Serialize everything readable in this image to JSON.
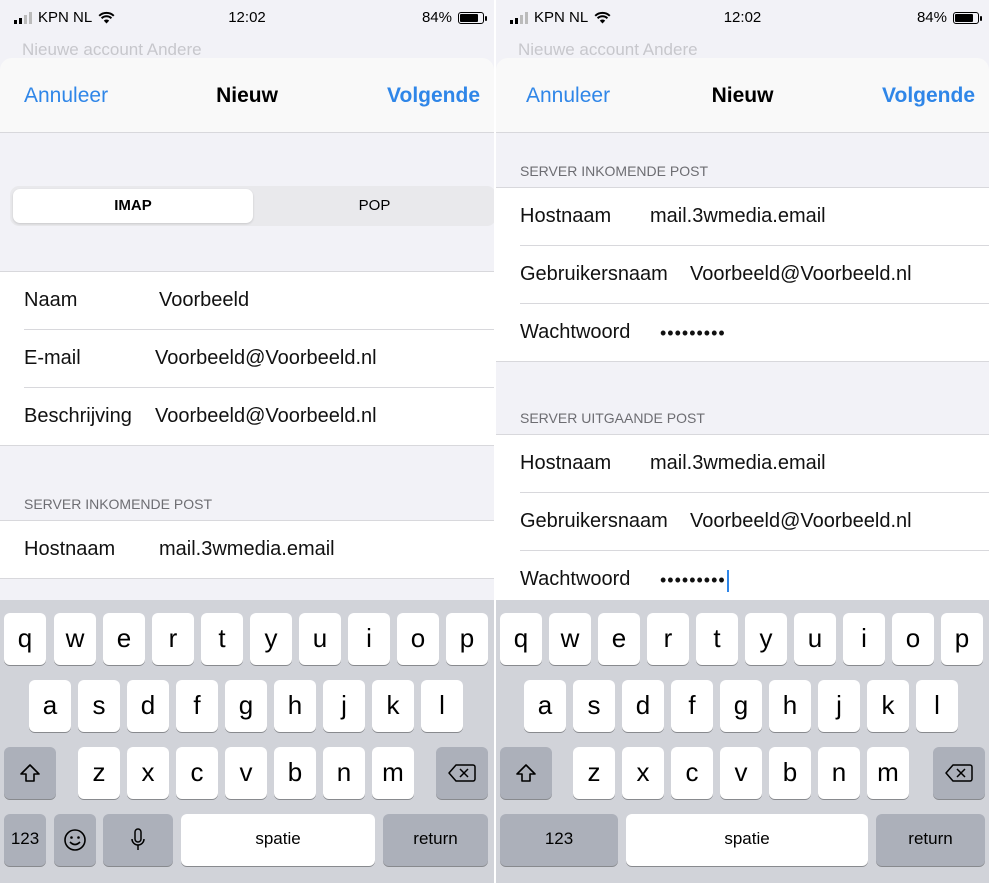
{
  "left": {
    "status": {
      "carrier": "KPN NL",
      "time": "12:02",
      "battery": "84%"
    },
    "behind_title": "Nieuwe account  Andere",
    "nav": {
      "cancel": "Annuleer",
      "title": "Nieuw",
      "next": "Volgende"
    },
    "segment": {
      "selected": "IMAP",
      "other": "POP"
    },
    "account": {
      "rows": [
        {
          "label": "Naam",
          "value": "Voorbeeld"
        },
        {
          "label": "E-mail",
          "value": "Voorbeeld@Voorbeeld.nl"
        },
        {
          "label": "Beschrijving",
          "value": "Voorbeeld@Voorbeeld.nl"
        }
      ]
    },
    "incoming": {
      "header": "SERVER INKOMENDE POST",
      "rows": [
        {
          "label": "Hostnaam",
          "value": "mail.3wmedia.email"
        }
      ]
    }
  },
  "right": {
    "status": {
      "carrier": "KPN NL",
      "time": "12:02",
      "battery": "84%"
    },
    "behind_title": "Nieuwe account  Andere",
    "nav": {
      "cancel": "Annuleer",
      "title": "Nieuw",
      "next": "Volgende"
    },
    "incoming": {
      "header": "SERVER INKOMENDE POST",
      "rows": [
        {
          "label": "Hostnaam",
          "value": "mail.3wmedia.email"
        },
        {
          "label": "Gebruikersnaam",
          "value": "Voorbeeld@Voorbeeld.nl"
        },
        {
          "label": "Wachtwoord",
          "value": "•••••••••"
        }
      ]
    },
    "outgoing": {
      "header": "SERVER UITGAANDE POST",
      "rows": [
        {
          "label": "Hostnaam",
          "value": "mail.3wmedia.email"
        },
        {
          "label": "Gebruikersnaam",
          "value": "Voorbeeld@Voorbeeld.nl"
        },
        {
          "label": "Wachtwoord",
          "value": "•••••••••"
        }
      ]
    }
  },
  "keyboard": {
    "row1": [
      "q",
      "w",
      "e",
      "r",
      "t",
      "y",
      "u",
      "i",
      "o",
      "p"
    ],
    "row2": [
      "a",
      "s",
      "d",
      "f",
      "g",
      "h",
      "j",
      "k",
      "l"
    ],
    "row3": [
      "z",
      "x",
      "c",
      "v",
      "b",
      "n",
      "m"
    ],
    "numbers_key": "123",
    "space_key": "spatie",
    "return_key": "return"
  },
  "colors": {
    "accent": "#2f86e8",
    "background": "#f2f2f7",
    "separator": "#d8d8dc"
  },
  "battery_level": 0.84
}
